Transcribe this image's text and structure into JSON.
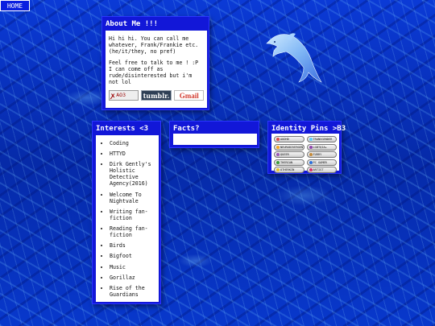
{
  "nav": {
    "home_label": "HOME"
  },
  "about": {
    "title": "About Me !!!",
    "para1": "Hi hi hi. You can call me whatever, Frank/Frankie etc. (he/it/they, no pref)",
    "para2": "Feel free to talk to me ! :P I can come off as rude/disinterested but i'm not lol",
    "badges": {
      "ao3": "AO3",
      "tumblr": "tumblr.",
      "gmail": "Gmail"
    }
  },
  "interests": {
    "title": "Interests <3",
    "items": [
      "Coding",
      "HTTYD",
      "Dirk Gently's Holistic Detective Agency(2016)",
      "Welcome To Nightvale",
      "Writing fan-fiction",
      "Reading fan-fiction",
      "Birds",
      "Bigfoot",
      "Music",
      "Gorillaz",
      "Rise of the Guardians"
    ]
  },
  "facts": {
    "title": "Facts?"
  },
  "pins": {
    "title": "Identity Pins >B3",
    "items": [
      {
        "label": "AUDHD",
        "color": "#e24a4a"
      },
      {
        "label": "TRANSGENDER",
        "color": "#5bcefa"
      },
      {
        "label": "NEURODIVERGENT",
        "color": "#f5a623"
      },
      {
        "label": "LGBTQIA+",
        "color": "#8e44ad"
      },
      {
        "label": "QUEER",
        "color": "#9b59b6"
      },
      {
        "label": "FURRY",
        "color": "#c48a3a"
      },
      {
        "label": "THERIAN",
        "color": "#3a9a3a"
      },
      {
        "label": "PC GAMER",
        "color": "#2a6fdb"
      },
      {
        "label": "OTHERKIN",
        "color": "#e6c229"
      },
      {
        "label": "ARTIST",
        "color": "#d6336c"
      }
    ]
  },
  "colors": {
    "panel_blue": "#1217d8",
    "page_blue": "#0a2fc9",
    "text_white": "#ffffff"
  }
}
